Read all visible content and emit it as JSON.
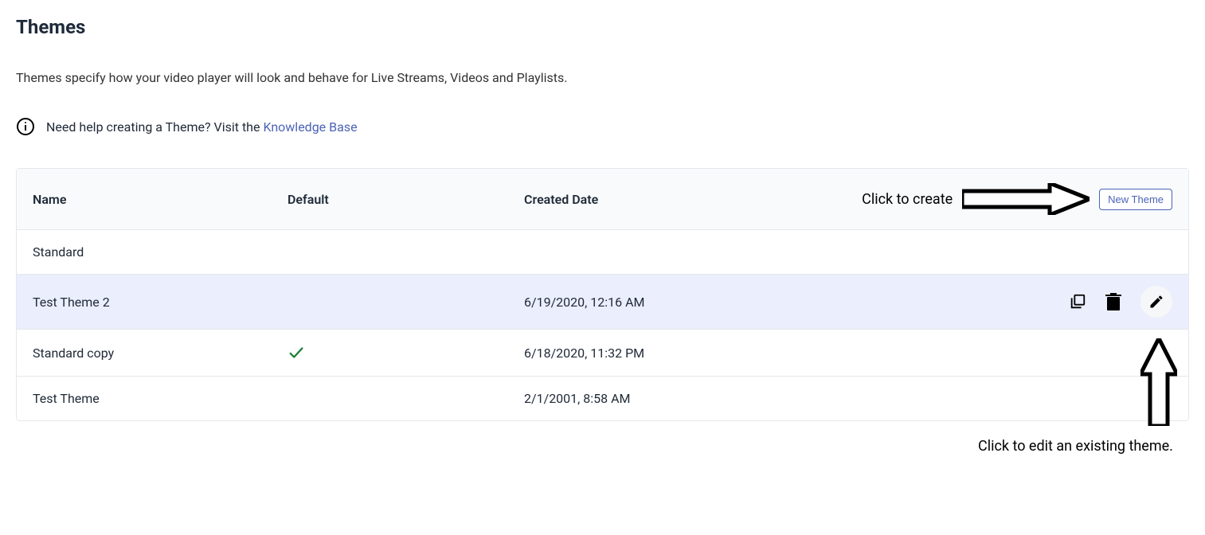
{
  "page": {
    "title": "Themes",
    "description": "Themes specify how your video player will look and behave for Live Streams, Videos and Playlists."
  },
  "help": {
    "text": "Need help creating a Theme? Visit the ",
    "link_label": "Knowledge Base"
  },
  "table": {
    "columns": {
      "name": "Name",
      "default": "Default",
      "created": "Created Date"
    },
    "new_button": "New Theme",
    "rows": [
      {
        "name": "Standard",
        "default": false,
        "created": "",
        "show_actions": false,
        "highlight": false
      },
      {
        "name": "Test Theme 2",
        "default": false,
        "created": "6/19/2020, 12:16 AM",
        "show_actions": true,
        "highlight": true
      },
      {
        "name": "Standard copy",
        "default": true,
        "created": "6/18/2020, 11:32 PM",
        "show_actions": false,
        "highlight": false
      },
      {
        "name": "Test Theme",
        "default": false,
        "created": "2/1/2001, 8:58 AM",
        "show_actions": false,
        "highlight": false
      }
    ]
  },
  "annotations": {
    "create": "Click to create",
    "edit": "Click to edit an existing theme."
  }
}
